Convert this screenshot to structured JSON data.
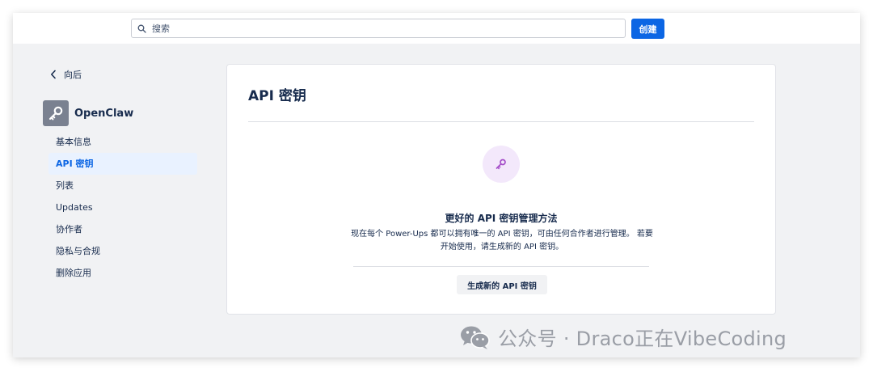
{
  "header": {
    "search_placeholder": "搜索",
    "create_label": "创建"
  },
  "sidebar": {
    "back_label": "向后",
    "app_name": "OpenClaw",
    "items": [
      {
        "label": "基本信息",
        "active": false
      },
      {
        "label": "API 密钥",
        "active": true
      },
      {
        "label": "列表",
        "active": false
      },
      {
        "label": "Updates",
        "active": false
      },
      {
        "label": "协作者",
        "active": false
      },
      {
        "label": "隐私与合规",
        "active": false
      },
      {
        "label": "删除应用",
        "active": false
      }
    ]
  },
  "main": {
    "title": "API 密钥",
    "empty_state": {
      "heading": "更好的 API 密钥管理方法",
      "description": "现在每个 Power-Ups 都可以拥有唯一的 API 密钥，可由任何合作者进行管理。 若要开始使用，请生成新的 API 密钥。",
      "button_label": "生成新的 API 密钥"
    }
  },
  "watermark": {
    "text": "公众号 · Draco正在VibeCoding"
  },
  "colors": {
    "primary": "#0c66e4",
    "active_nav_bg": "#e9f2ff",
    "key_icon_bg": "#f3e8fb",
    "key_icon": "#a54fc9",
    "page_bg": "#f1f2f4"
  },
  "icons": {
    "search": "search-icon",
    "back": "chevron-left-icon",
    "app": "key-icon",
    "empty": "key-icon",
    "watermark": "wechat-icon"
  }
}
